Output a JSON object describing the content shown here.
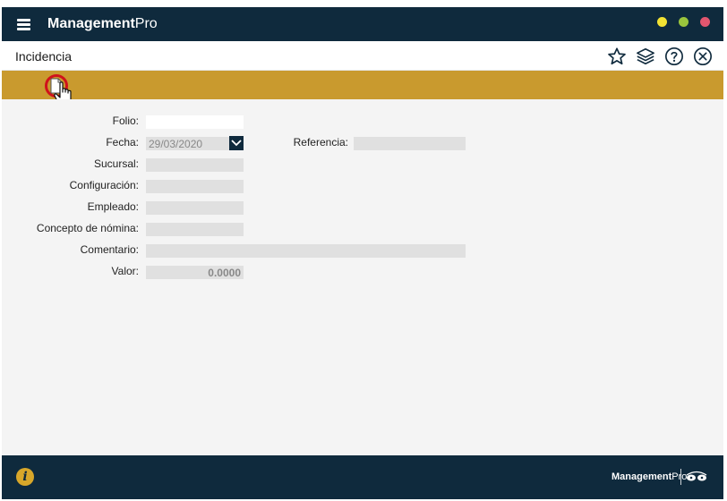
{
  "app": {
    "brand_bold": "Management",
    "brand_light": "Pro",
    "window_controls": [
      "minimize",
      "maximize",
      "close"
    ],
    "colors": {
      "titlebar": "#0f2a3d",
      "toolbar": "#c99a2e",
      "highlight_ring": "#d0121b",
      "dot_yellow": "#f2e233",
      "dot_green": "#9bc53d",
      "dot_red": "#e2566f"
    }
  },
  "module": {
    "title": "Incidencia",
    "actions": [
      "star-icon",
      "layers-icon",
      "help-icon",
      "close-icon"
    ]
  },
  "toolbar": {
    "buttons": [
      "new-document-icon"
    ]
  },
  "form": {
    "folio": {
      "label": "Folio:",
      "value": ""
    },
    "fecha": {
      "label": "Fecha:",
      "value": "29/03/2020"
    },
    "referencia": {
      "label": "Referencia:",
      "value": ""
    },
    "sucursal": {
      "label": "Sucursal:",
      "value": ""
    },
    "configuracion": {
      "label": "Configuración:",
      "value": ""
    },
    "empleado": {
      "label": "Empleado:",
      "value": ""
    },
    "concepto": {
      "label": "Concepto de nómina:",
      "value": ""
    },
    "comentario": {
      "label": "Comentario:",
      "value": ""
    },
    "valor": {
      "label": "Valor:",
      "value": "0.0000"
    }
  },
  "footer": {
    "info_glyph": "i",
    "brand_bold": "Management",
    "brand_light": "Pro"
  }
}
